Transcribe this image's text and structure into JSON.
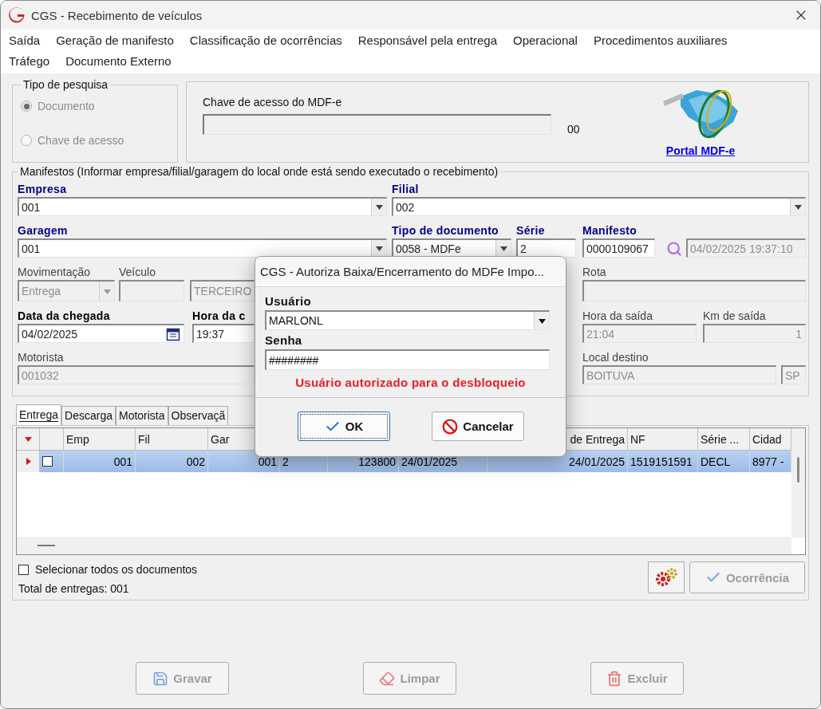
{
  "window": {
    "title": "CGS - Recebimento de veículos"
  },
  "menu": [
    "Saída",
    "Geração de manifesto",
    "Classificação de ocorrências",
    "Responsável pela entrega",
    "Operacional",
    "Procedimentos auxiliares",
    "Tráfego",
    "Documento Externo"
  ],
  "search_type": {
    "title": "Tipo de pesquisa",
    "disabled": true,
    "options": [
      {
        "label": "Documento",
        "selected": true
      },
      {
        "label": "Chave de acesso",
        "selected": false
      }
    ]
  },
  "access_key": {
    "label": "Chave de acesso do MDF-e",
    "code": "00",
    "link": "Portal MDF-e"
  },
  "manifestos": {
    "title": "Manifestos (Informar empresa/filial/garagem do local onde está sendo executado o recebimento)",
    "lines": [
      {
        "fields": [
          {
            "kind": "combo",
            "label": "Empresa",
            "required": true,
            "bold": true,
            "value": "001",
            "disabled": false
          },
          {
            "kind": "combo",
            "label": "Filial",
            "required": true,
            "bold": true,
            "value": "002",
            "disabled": false
          }
        ]
      },
      {
        "fields": [
          {
            "kind": "combo",
            "label": "Garagem",
            "required": true,
            "bold": true,
            "value": "001",
            "disabled": false
          },
          {
            "kind": "combo",
            "label": "Tipo de documento",
            "required": true,
            "bold": true,
            "value": "0058 - MDFe",
            "disabled": false
          },
          {
            "kind": "text",
            "label": "Série",
            "required": true,
            "bold": true,
            "value": "2",
            "disabled": false
          },
          {
            "kind": "text",
            "label": "Manifesto",
            "required": true,
            "bold": true,
            "value": "0000109067",
            "disabled": false
          },
          {
            "kind": "search"
          },
          {
            "kind": "text",
            "value": "04/02/2025 19:37:10",
            "disabled": true
          }
        ]
      },
      {
        "fields": [
          {
            "kind": "combo",
            "label": "Movimentação",
            "required": false,
            "bold": false,
            "value": "Entrega",
            "disabled": true
          },
          {
            "kind": "text",
            "label": "Veículo",
            "required": false,
            "bold": false,
            "disabled": true
          },
          {
            "kind": "text",
            "value": "TERCEIRO",
            "disabled": true
          },
          {
            "kind": "text",
            "label": "Rota",
            "required": false,
            "bold": false,
            "disabled": true
          }
        ]
      },
      {
        "fields": [
          {
            "kind": "date",
            "label": "Data da chegada",
            "required": false,
            "bold": true,
            "value": "04/02/2025",
            "disabled": false
          },
          {
            "kind": "text",
            "label": "Hora da c",
            "required": false,
            "bold": true,
            "value": "19:37",
            "disabled": false
          },
          {
            "kind": "text",
            "label": "Hora da saída",
            "required": false,
            "bold": false,
            "value": "21:04",
            "disabled": true
          },
          {
            "kind": "number",
            "label": "Km de saída",
            "required": false,
            "bold": false,
            "value": "1",
            "disabled": true
          }
        ]
      },
      {
        "fields": [
          {
            "kind": "text",
            "label": "Motorista",
            "required": false,
            "bold": false,
            "value": "001032",
            "disabled": true
          },
          {
            "kind": "text",
            "label": "Local destino",
            "required": false,
            "bold": false,
            "value": "BOITUVA",
            "disabled": true
          },
          {
            "kind": "text",
            "value": "SP",
            "disabled": true
          }
        ]
      }
    ]
  },
  "tabs": [
    {
      "label": "Entrega",
      "selected": true
    },
    {
      "label": "Descarga",
      "selected": false
    },
    {
      "label": "Motorista",
      "selected": false
    },
    {
      "label": "Observaçã",
      "selected": false
    }
  ],
  "grid": {
    "columns": [
      {
        "label": "Emp"
      },
      {
        "label": "Fil"
      },
      {
        "label": "Gar"
      },
      {},
      {},
      {},
      {
        "label": "de Entrega"
      },
      {
        "label": "NF"
      },
      {
        "label": "Série ..."
      },
      {
        "label": "Cidad"
      }
    ],
    "rows": [
      {
        "selected": true,
        "checked": false,
        "cells": [
          "001",
          "002",
          "001",
          "2",
          "123800",
          "24/01/2025",
          "24/01/2025",
          "1519151591",
          "DECL",
          "8977 -"
        ]
      }
    ]
  },
  "select_all": {
    "label": "Selecionar todos os documentos",
    "checked": false
  },
  "total": "Total de entregas: 001",
  "occurrence_button": {
    "label": "Ocorrência",
    "disabled": true
  },
  "actions": [
    {
      "label": "Gravar",
      "disabled": true
    },
    {
      "label": "Limpar",
      "disabled": true
    },
    {
      "label": "Excluir",
      "disabled": true
    }
  ],
  "dialog": {
    "title": "CGS - Autoriza Baixa/Encerramento do MDFe Impo...",
    "user_label": "Usuário",
    "user": "MARLONL",
    "password_label": "Senha",
    "password": "########",
    "message": "Usuário autorizado para o desbloqueio",
    "buttons": [
      {
        "label": "OK",
        "focused": true
      },
      {
        "label": "Cancelar",
        "focused": false
      }
    ]
  }
}
